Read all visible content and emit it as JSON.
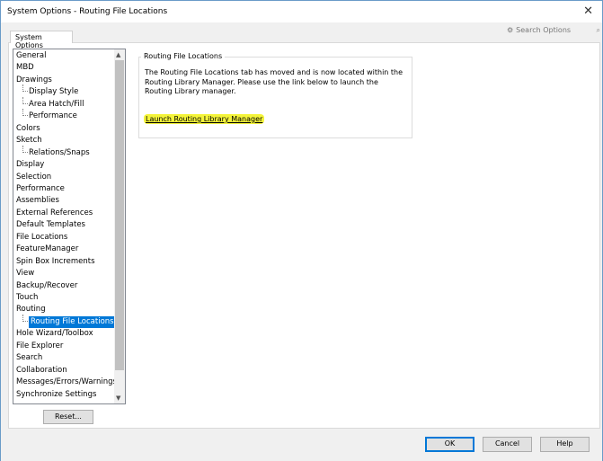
{
  "window": {
    "title": "System Options - Routing File Locations",
    "close": "✕"
  },
  "search": {
    "placeholder": "Search Options",
    "icon": "gear-icon",
    "search_icon": "magnifier-icon"
  },
  "tabs": [
    {
      "label": "System Options"
    }
  ],
  "tree": {
    "items": [
      {
        "label": "General",
        "level": 0
      },
      {
        "label": "MBD",
        "level": 0
      },
      {
        "label": "Drawings",
        "level": 0
      },
      {
        "label": "Display Style",
        "level": 1
      },
      {
        "label": "Area Hatch/Fill",
        "level": 1
      },
      {
        "label": "Performance",
        "level": 1
      },
      {
        "label": "Colors",
        "level": 0
      },
      {
        "label": "Sketch",
        "level": 0
      },
      {
        "label": "Relations/Snaps",
        "level": 1
      },
      {
        "label": "Display",
        "level": 0
      },
      {
        "label": "Selection",
        "level": 0
      },
      {
        "label": "Performance",
        "level": 0
      },
      {
        "label": "Assemblies",
        "level": 0
      },
      {
        "label": "External References",
        "level": 0
      },
      {
        "label": "Default Templates",
        "level": 0
      },
      {
        "label": "File Locations",
        "level": 0
      },
      {
        "label": "FeatureManager",
        "level": 0
      },
      {
        "label": "Spin Box Increments",
        "level": 0
      },
      {
        "label": "View",
        "level": 0
      },
      {
        "label": "Backup/Recover",
        "level": 0
      },
      {
        "label": "Touch",
        "level": 0
      },
      {
        "label": "Routing",
        "level": 0
      },
      {
        "label": "Routing File Locations",
        "level": 1,
        "selected": true
      },
      {
        "label": "Hole Wizard/Toolbox",
        "level": 0
      },
      {
        "label": "File Explorer",
        "level": 0
      },
      {
        "label": "Search",
        "level": 0
      },
      {
        "label": "Collaboration",
        "level": 0
      },
      {
        "label": "Messages/Errors/Warnings",
        "level": 0
      },
      {
        "label": "Synchronize Settings",
        "level": 0
      }
    ]
  },
  "reset_label": "Reset...",
  "content": {
    "group_title": "Routing File Locations",
    "message": "The Routing File Locations tab has moved and is now located within the Routing Library Manager. Please use the link below to launch the Routing Library manager.",
    "link": "Launch Routing Library Manager",
    "highlight_color": "#f4f43a"
  },
  "buttons": {
    "ok": "OK",
    "cancel": "Cancel",
    "help": "Help"
  },
  "accent": "#0078d7"
}
